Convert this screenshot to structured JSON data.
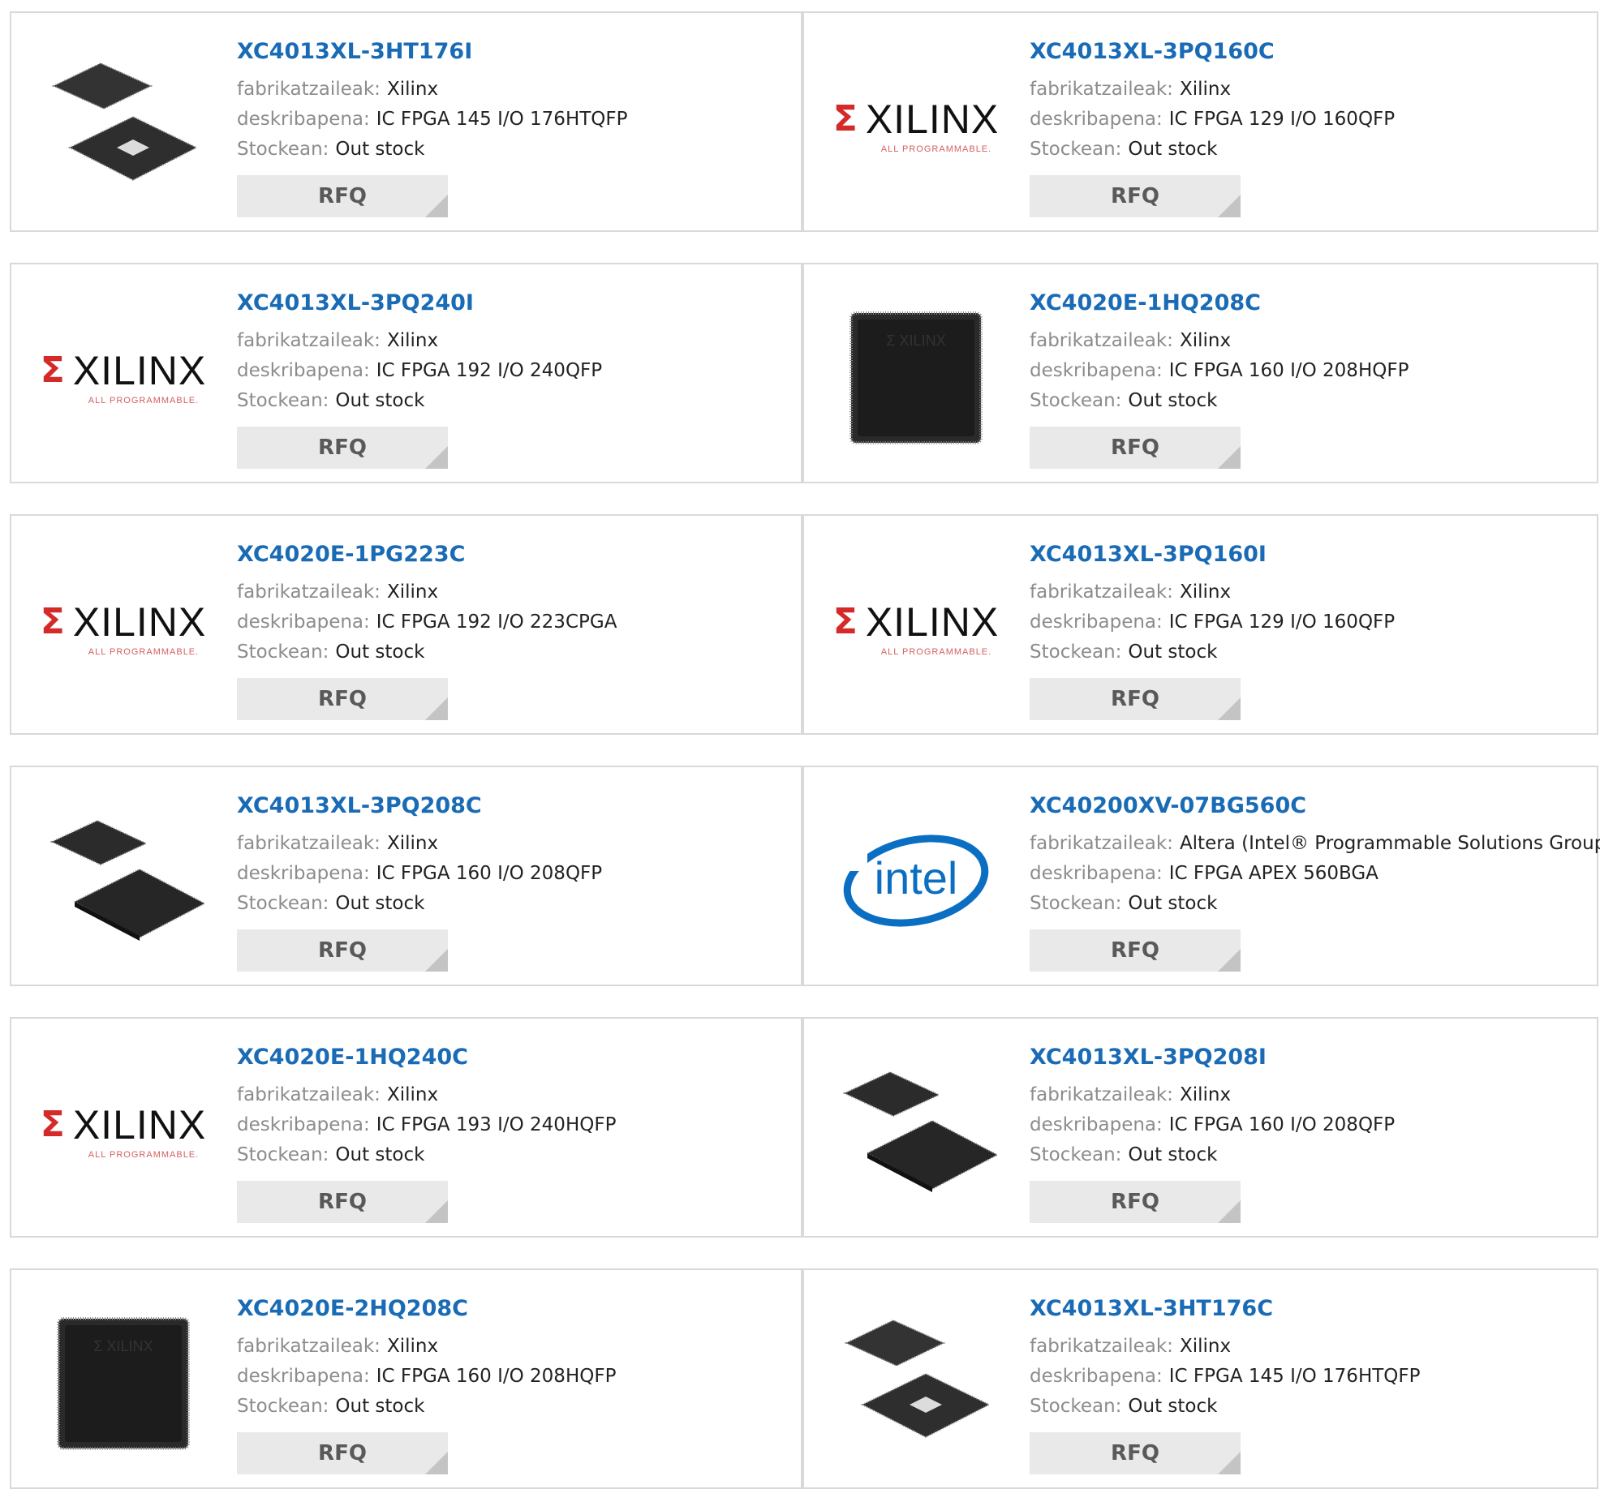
{
  "labels": {
    "manufacturer": "fabrikatzaileak:",
    "description": "deskribapena:",
    "stock": "Stockean:",
    "rfq": "RFQ"
  },
  "logos": {
    "xilinx_word": "XILINX",
    "xilinx_tagline": "ALL PROGRAMMABLE.",
    "intel_word": "intel"
  },
  "colors": {
    "link": "#1a6bb5",
    "label": "#8c8c8c",
    "value": "#222222",
    "card_border": "#d9d9d9",
    "rfq_bg": "#e9e9e9",
    "xilinx_red": "#d42a2a",
    "intel_blue": "#0a6ec2"
  },
  "products": [
    {
      "part": "XC4013XL-3HT176I",
      "manufacturer": "Xilinx",
      "description": "IC FPGA 145 I/O 176HTQFP",
      "stock": "Out stock",
      "image": "qfp-chip-pair-icon"
    },
    {
      "part": "XC4013XL-3PQ160C",
      "manufacturer": "Xilinx",
      "description": "IC FPGA 129 I/O 160QFP",
      "stock": "Out stock",
      "image": "xilinx-logo"
    },
    {
      "part": "XC4013XL-3PQ240I",
      "manufacturer": "Xilinx",
      "description": "IC FPGA 192 I/O 240QFP",
      "stock": "Out stock",
      "image": "xilinx-logo"
    },
    {
      "part": "XC4020E-1HQ208C",
      "manufacturer": "Xilinx",
      "description": "IC FPGA 160 I/O 208HQFP",
      "stock": "Out stock",
      "image": "black-chip-icon"
    },
    {
      "part": "XC4020E-1PG223C",
      "manufacturer": "Xilinx",
      "description": "IC FPGA 192 I/O 223CPGA",
      "stock": "Out stock",
      "image": "xilinx-logo"
    },
    {
      "part": "XC4013XL-3PQ160I",
      "manufacturer": "Xilinx",
      "description": "IC FPGA 129 I/O 160QFP",
      "stock": "Out stock",
      "image": "xilinx-logo"
    },
    {
      "part": "XC4013XL-3PQ208C",
      "manufacturer": "Xilinx",
      "description": "IC FPGA 160 I/O 208QFP",
      "stock": "Out stock",
      "image": "qfp-chip-pair-dark-icon"
    },
    {
      "part": "XC40200XV-07BG560C",
      "manufacturer": "Altera (Intel® Programmable Solutions Group)",
      "description": "IC FPGA APEX 560BGA",
      "stock": "Out stock",
      "image": "intel-logo"
    },
    {
      "part": "XC4020E-1HQ240C",
      "manufacturer": "Xilinx",
      "description": "IC FPGA 193 I/O 240HQFP",
      "stock": "Out stock",
      "image": "xilinx-logo"
    },
    {
      "part": "XC4013XL-3PQ208I",
      "manufacturer": "Xilinx",
      "description": "IC FPGA 160 I/O 208QFP",
      "stock": "Out stock",
      "image": "qfp-chip-pair-dark-icon"
    },
    {
      "part": "XC4020E-2HQ208C",
      "manufacturer": "Xilinx",
      "description": "IC FPGA 160 I/O 208HQFP",
      "stock": "Out stock",
      "image": "black-chip-icon"
    },
    {
      "part": "XC4013XL-3HT176C",
      "manufacturer": "Xilinx",
      "description": "IC FPGA 145 I/O 176HTQFP",
      "stock": "Out stock",
      "image": "qfp-chip-pair-icon"
    }
  ]
}
